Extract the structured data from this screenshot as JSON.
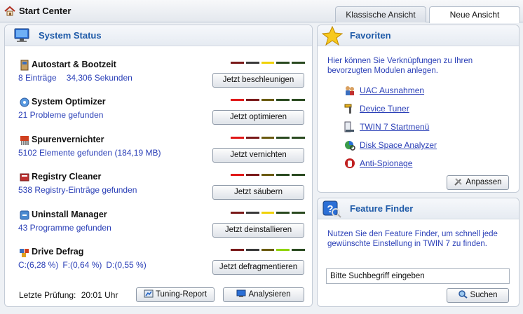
{
  "window": {
    "title": "Start Center"
  },
  "tabs": [
    {
      "label": "Klassische Ansicht"
    },
    {
      "label": "Neue Ansicht"
    }
  ],
  "system_status": {
    "title": "System Status",
    "items": [
      {
        "name": "Autostart & Bootzeit",
        "info": [
          "8 Einträge",
          "34,306 Sekunden"
        ],
        "button": "Jetzt beschleunigen",
        "icon": "autostart-icon",
        "level": 0.6
      },
      {
        "name": "System Optimizer",
        "info": [
          "21 Probleme gefunden"
        ],
        "button": "Jetzt optimieren",
        "icon": "optimizer-icon",
        "level": 0.2
      },
      {
        "name": "Spurenvernichter",
        "info": [
          "5102 Elemente gefunden (184,19 MB)"
        ],
        "button": "Jetzt vernichten",
        "icon": "shredder-icon",
        "level": 0.2
      },
      {
        "name": "Registry Cleaner",
        "info": [
          "538 Registry-Einträge gefunden"
        ],
        "button": "Jetzt säubern",
        "icon": "registry-icon",
        "level": 0.2
      },
      {
        "name": "Uninstall Manager",
        "info": [
          "43 Programme gefunden"
        ],
        "button": "Jetzt deinstallieren",
        "icon": "uninstall-icon",
        "level": 0.6
      },
      {
        "name": "Drive Defrag",
        "info": [
          "C:(6,28 %)",
          "F:(0,64 %)",
          "D:(0,55 %)"
        ],
        "button": "Jetzt defragmentieren",
        "icon": "defrag-icon",
        "level": 0.8
      }
    ],
    "last_check_label": "Letzte Prüfung:",
    "last_check_time": "20:01 Uhr",
    "report_button": "Tuning-Report",
    "analyse_button": "Analysieren"
  },
  "favorites": {
    "title": "Favoriten",
    "description": "Hier können Sie Verknüpfungen zu Ihren bevorzugten Modulen anlegen.",
    "links": [
      {
        "label": "UAC Ausnahmen",
        "icon": "uac-icon"
      },
      {
        "label": "Device Tuner",
        "icon": "device-tuner-icon"
      },
      {
        "label": "TWIN 7 Startmenü",
        "icon": "startmenu-icon"
      },
      {
        "label": "Disk Space Analyzer",
        "icon": "disk-analyzer-icon"
      },
      {
        "label": "Anti-Spionage",
        "icon": "anti-spy-icon"
      }
    ],
    "customize_button": "Anpassen"
  },
  "feature_finder": {
    "title": "Feature Finder",
    "description": "Nutzen Sie den Feature Finder, um schnell jede gewünschte Einstellung in TWIN 7 zu finden.",
    "search_value": "Bitte Suchbegriff eingeben",
    "search_button": "Suchen"
  },
  "colors": {
    "accent": "#1e5aa8",
    "link": "#2a3fb7",
    "meter_red": "#e01818",
    "meter_yellow": "#f0d20a",
    "meter_green": "#8fd400",
    "meter_off": "#3a3a3a"
  }
}
